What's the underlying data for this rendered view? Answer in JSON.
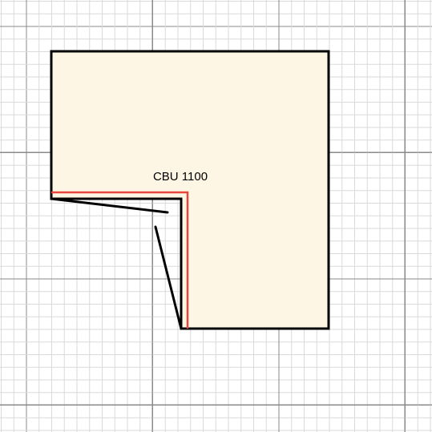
{
  "colors": {
    "background": "#ffffff",
    "grid_minor": "#dadada",
    "grid_major": "#8a8a8a",
    "cabinet_fill": "#fdf6e4",
    "cabinet_outline": "#000000",
    "front_edge": "#e8453c",
    "door_line": "#000000",
    "label_text": "#000000"
  },
  "cabinet": {
    "label": "CBU 1100",
    "shape": "corner base unit, L-shaped with open corner doors"
  },
  "grid": {
    "visible": true
  }
}
